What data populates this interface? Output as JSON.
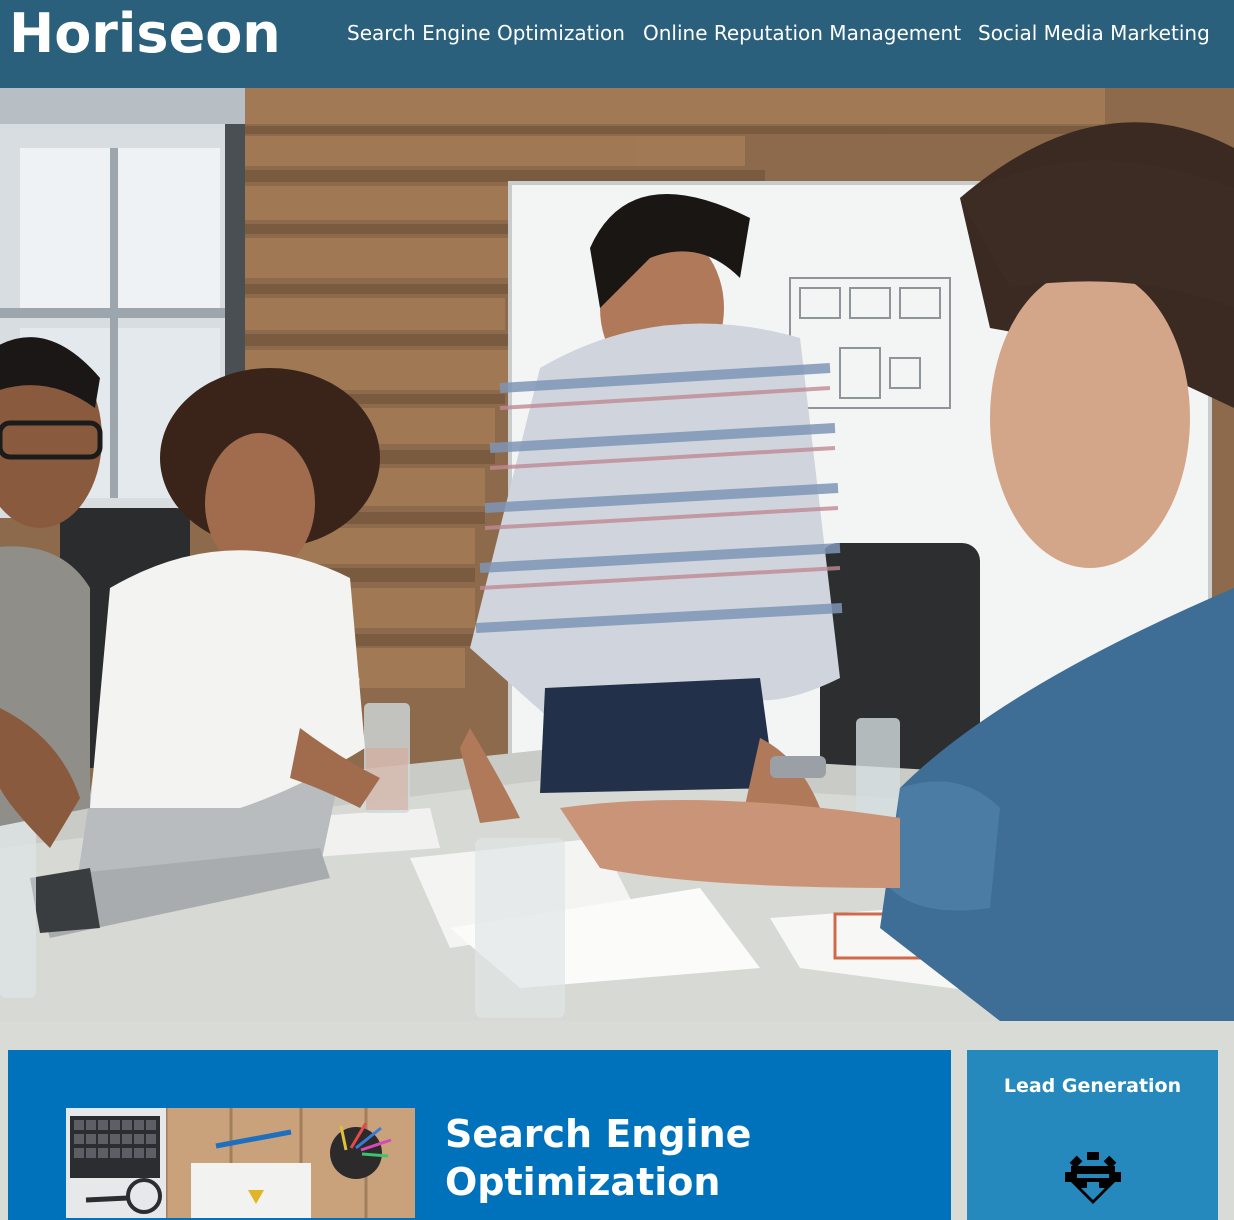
{
  "header": {
    "logo": "Horiseon",
    "nav": [
      {
        "label": "Search Engine Optimization"
      },
      {
        "label": "Online Reputation Management"
      },
      {
        "label": "Social Media Marketing"
      }
    ]
  },
  "hero": {
    "image_desc": "team-meeting-photo"
  },
  "content": {
    "section_title": "Search Engine Optimization"
  },
  "aside": {
    "title": "Lead Generation",
    "icon": "lead-generation-icon"
  },
  "colors": {
    "header_bg": "#2a607c",
    "content_bg": "#0072bb",
    "aside_bg": "#2589bd",
    "page_bg": "#d9dcd6"
  }
}
